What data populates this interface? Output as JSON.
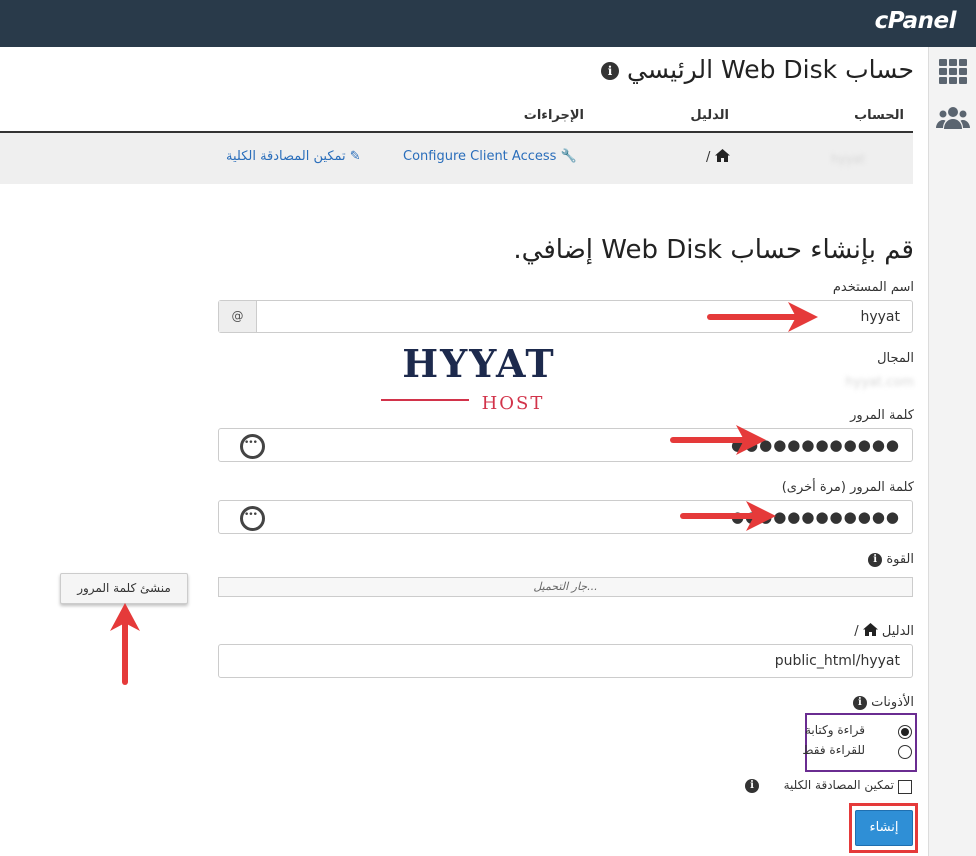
{
  "brand": {
    "logo": "cPanel"
  },
  "rail": {
    "icons": [
      "grid-icon",
      "users-icon"
    ]
  },
  "page": {
    "title": "حساب Web Disk الرئيسي",
    "columns": {
      "account": "الحساب",
      "directory": "الدليل",
      "actions": "الإجراءات"
    },
    "row": {
      "account": "hyyat",
      "directory": "/",
      "configure_label": "Configure Client Access",
      "digest_label": "تمكين المصادقة الكلية"
    }
  },
  "form": {
    "title": "قم بإنشاء حساب Web Disk إضافي.",
    "username_label": "اسم المستخدم",
    "username_value": "hyyat",
    "at_symbol": "@",
    "domain_label": "المجال",
    "domain_value": "hyyat.com",
    "password_label": "كلمة المرور",
    "password_mask": "●●●●●●●●●●●●",
    "password_again_label": "كلمة المرور (مرة أخرى)",
    "password_again_mask": "●●●●●●●●●●●●",
    "strength_label": "القوة",
    "strength_loading": "جار التحميل...",
    "generator_button": "منشئ كلمة المرور",
    "directory_label": "الدليل",
    "directory_slash": "/",
    "directory_value": "public_html/hyyat",
    "permissions_label": "الأذونات",
    "perm_read_write": "قراءة وكتابة",
    "perm_read_only": "للقراءة فقط",
    "digest_auth_label": "تمكين المصادقة الكلية",
    "create_button": "إنشاء"
  },
  "watermark": {
    "line1": "HYYAT",
    "line2": "HOST"
  },
  "colors": {
    "topbar": "#293a4a",
    "link": "#2a6ebb",
    "primary": "#2f8fd6",
    "annotation": "#e53a3a",
    "highlight": "#6a2c91",
    "logo_red": "#d2334a",
    "logo_navy": "#1d2a4d"
  }
}
